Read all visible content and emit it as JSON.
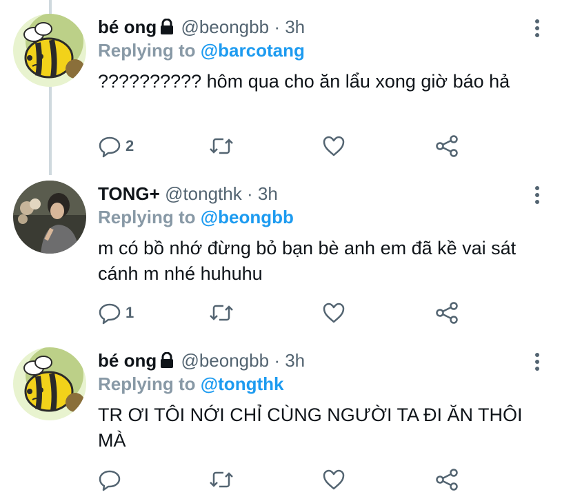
{
  "tweets": [
    {
      "name": "bé ong",
      "handle": "@beongbb",
      "sep": "·",
      "time": "3h",
      "locked": true,
      "reply_prefix": "Replying to",
      "reply_to": "@barcotang",
      "text": "?????????? hôm qua cho ăn lẩu xong giờ báo hả",
      "reply_count": "2",
      "retweet_count": "",
      "like_count": ""
    },
    {
      "name": "TONG+",
      "handle": "@tongthk",
      "sep": "·",
      "time": "3h",
      "locked": false,
      "reply_prefix": "Replying to",
      "reply_to": "@beongbb",
      "text": "m có bồ nhớ đừng bỏ bạn bè anh em đã kề vai sát cánh m nhé huhuhu",
      "reply_count": "1",
      "retweet_count": "",
      "like_count": ""
    },
    {
      "name": "bé ong",
      "handle": "@beongbb",
      "sep": "·",
      "time": "3h",
      "locked": true,
      "reply_prefix": "Replying to",
      "reply_to": "@tongthk",
      "text": "TR ƠI TÔI NỚI CHỈ CÙNG NGƯỜI TA ĐI ĂN THÔI MÀ",
      "reply_count": "",
      "retweet_count": "",
      "like_count": ""
    }
  ],
  "icons": {
    "lock": "lock-icon",
    "reply": "reply-icon",
    "retweet": "retweet-icon",
    "like": "heart-icon",
    "share": "share-icon",
    "more": "more-icon"
  },
  "colors": {
    "link": "#1d9bf0",
    "muted": "#536471",
    "reply_label": "#8899a6",
    "thread_line": "#cfd9de"
  }
}
